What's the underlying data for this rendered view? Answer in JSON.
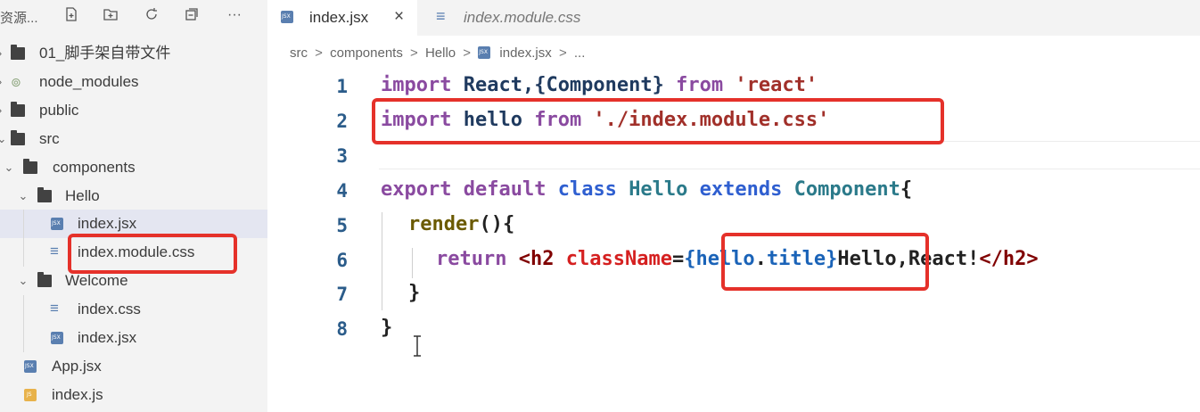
{
  "sidebar": {
    "title": "资源...",
    "actions": [
      "new-file-icon",
      "new-folder-icon",
      "refresh-icon",
      "collapse-all-icon",
      "more-icon"
    ],
    "more_label": "···",
    "tree": [
      {
        "label": "01_脚手架自带文件",
        "type": "folder",
        "expanded": false
      },
      {
        "label": "node_modules",
        "type": "node-modules",
        "expanded": false
      },
      {
        "label": "public",
        "type": "folder",
        "expanded": false
      },
      {
        "label": "src",
        "type": "folder",
        "expanded": true
      },
      {
        "label": "components",
        "type": "folder",
        "expanded": true
      },
      {
        "label": "Hello",
        "type": "folder",
        "expanded": true
      },
      {
        "label": "index.jsx",
        "type": "jsx",
        "selected": true
      },
      {
        "label": "index.module.css",
        "type": "css"
      },
      {
        "label": "Welcome",
        "type": "folder",
        "expanded": true
      },
      {
        "label": "index.css",
        "type": "css"
      },
      {
        "label": "index.jsx",
        "type": "jsx"
      },
      {
        "label": "App.jsx",
        "type": "jsx"
      },
      {
        "label": "index.js",
        "type": "js"
      }
    ]
  },
  "tabs": [
    {
      "label": "index.jsx",
      "active": true,
      "close": "×"
    },
    {
      "label": "index.module.css",
      "active": false
    }
  ],
  "breadcrumb": {
    "parts": [
      "src",
      "components",
      "Hello",
      "index.jsx",
      "..."
    ],
    "sep": ">"
  },
  "editor": {
    "line_numbers": [
      "1",
      "2",
      "3",
      "4",
      "5",
      "6",
      "7",
      "8"
    ],
    "lines": {
      "l1": [
        "import",
        " React,{Component} ",
        "from",
        " 'react'"
      ],
      "l2": [
        "import",
        " hello ",
        "from",
        " './index.module.css'"
      ],
      "l4": [
        "export",
        " ",
        "default",
        " ",
        "class",
        " ",
        "Hello",
        " ",
        "extends",
        " ",
        "Component",
        "{"
      ],
      "l5": [
        "render",
        "(){"
      ],
      "l6": [
        "return",
        " ",
        "<h2",
        " ",
        "className",
        "=",
        "{hello",
        ".",
        "title",
        "}",
        "Hello,React!",
        "</h2>"
      ],
      "l7": [
        "}"
      ],
      "l8": [
        "}"
      ]
    }
  },
  "colors": {
    "highlight": "#e5312a",
    "keyword": "#8a4aa0",
    "string": "#a1302a"
  }
}
